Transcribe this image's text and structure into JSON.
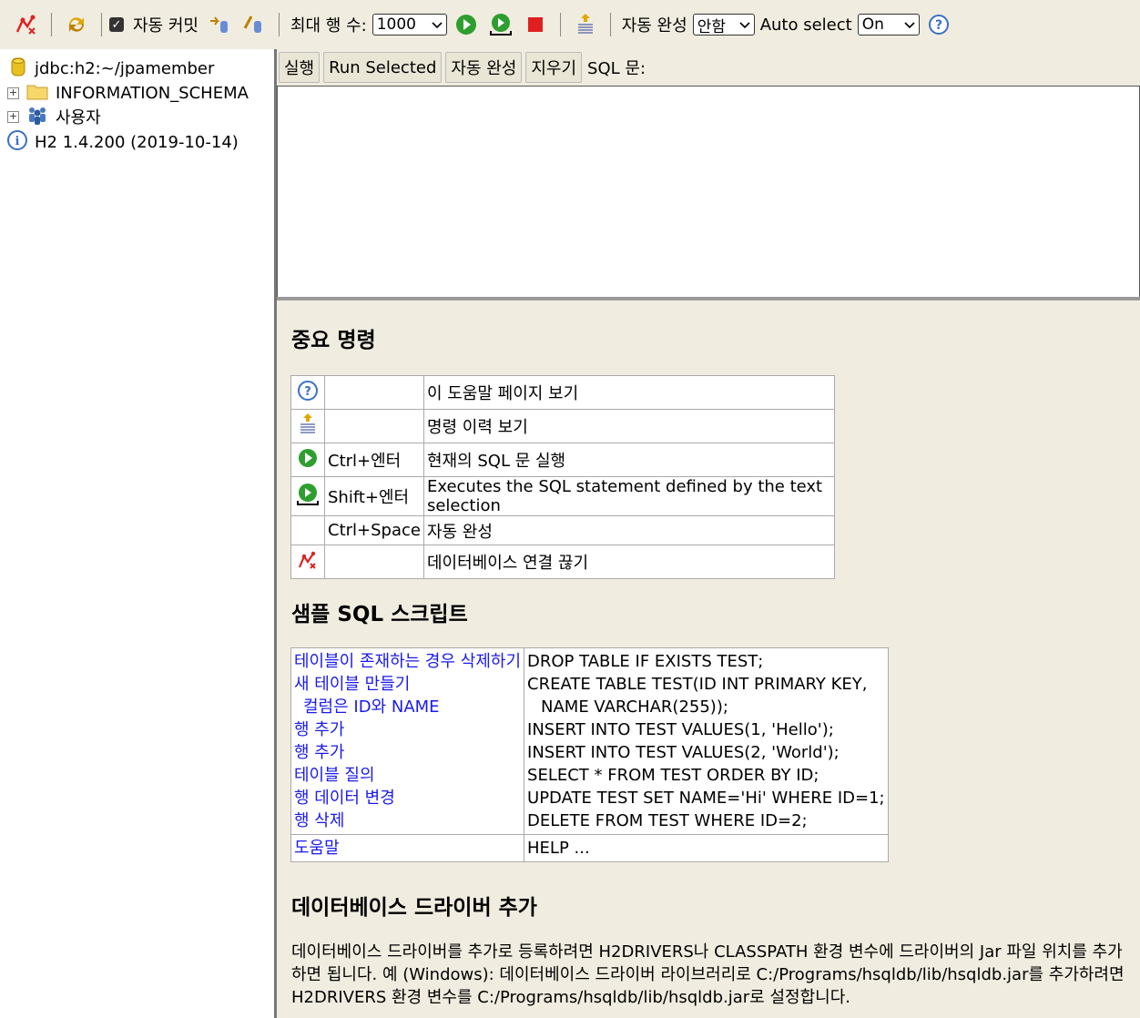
{
  "toolbar": {
    "auto_commit_label": "자동 커밋",
    "max_rows_label": "최대 행 수:",
    "max_rows_value": "1000",
    "autocomplete_label": "자동 완성",
    "autocomplete_value": "안함",
    "auto_select_label": "Auto select",
    "auto_select_value": "On"
  },
  "tree": {
    "connection": "jdbc:h2:~/jpamember",
    "schema": "INFORMATION_SCHEMA",
    "users": "사용자",
    "version": "H2 1.4.200 (2019-10-14)"
  },
  "query": {
    "run_label": "실행",
    "run_selected_label": "Run Selected",
    "autocomplete_label": "자동 완성",
    "clear_label": "지우기",
    "sql_label": "SQL 문:"
  },
  "important": {
    "title": "중요 명령",
    "rows": [
      {
        "icon": "help-icon",
        "key": "",
        "desc": "이 도움말 페이지 보기"
      },
      {
        "icon": "history-icon",
        "key": "",
        "desc": "명령 이력 보기"
      },
      {
        "icon": "run-icon",
        "key": "Ctrl+엔터",
        "desc": "현재의 SQL 문 실행"
      },
      {
        "icon": "run-selected-icon",
        "key": "Shift+엔터",
        "desc": "Executes the SQL statement defined by the text selection"
      },
      {
        "icon": "",
        "key": "Ctrl+Space",
        "desc": "자동 완성"
      },
      {
        "icon": "disconnect-icon",
        "key": "",
        "desc": "데이터베이스 연결 끊기"
      }
    ]
  },
  "samples": {
    "title": "샘플 SQL 스크립트",
    "rows": [
      {
        "label": "테이블이 존재하는 경우 삭제하기",
        "sql": "DROP TABLE IF EXISTS TEST;"
      },
      {
        "label": "새 테이블 만들기",
        "sql": "CREATE TABLE TEST(ID INT PRIMARY KEY,"
      },
      {
        "label": "컬럼은 ID와 NAME",
        "sql": "NAME VARCHAR(255));"
      },
      {
        "label": "행 추가",
        "sql": "INSERT INTO TEST VALUES(1, 'Hello');"
      },
      {
        "label": "행 추가",
        "sql": "INSERT INTO TEST VALUES(2, 'World');"
      },
      {
        "label": "테이블 질의",
        "sql": "SELECT * FROM TEST ORDER BY ID;"
      },
      {
        "label": "행 데이터 변경",
        "sql": "UPDATE TEST SET NAME='Hi' WHERE ID=1;"
      },
      {
        "label": "행 삭제",
        "sql": "DELETE FROM TEST WHERE ID=2;"
      }
    ],
    "help_label": "도움말",
    "help_sql": "HELP ..."
  },
  "drivers": {
    "title": "데이터베이스 드라이버 추가",
    "text": "데이터베이스 드라이버를 추가로 등록하려면 H2DRIVERS나 CLASSPATH 환경 변수에 드라이버의 Jar 파일 위치를 추가하면 됩니다. 예 (Windows): 데이터베이스 드라이버 라이브러리로 C:/Programs/hsqldb/lib/hsqldb.jar를 추가하려면 H2DRIVERS 환경 변수를 C:/Programs/hsqldb/lib/hsqldb.jar로 설정합니다."
  }
}
